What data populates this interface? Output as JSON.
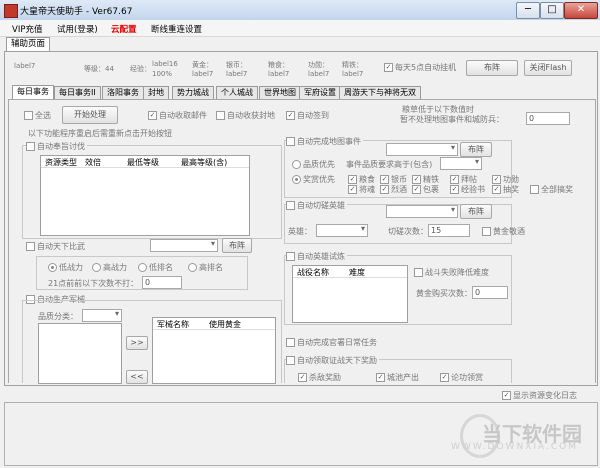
{
  "window": {
    "title": "大皇帝天使助手 - Ver67.67",
    "min": "─",
    "max": "□",
    "close": "✕"
  },
  "menu": {
    "items": [
      "VIP充值",
      "试用(登录)",
      "云配置",
      "断线重连设置"
    ],
    "accent": "#e00000"
  },
  "main_tab": "辅助页面",
  "stats": {
    "label17_a": "label7",
    "level_label": "等级：44",
    "exp_label": "经验：",
    "exp_value": "label16",
    "exp_pct": "100%",
    "gold_label": "黄金：",
    "gold_value": "label7",
    "silver_label": "银币：",
    "silver_value": "label7",
    "food_label": "粮食：",
    "food_value": "label7",
    "merit_label": "功勋：",
    "merit_value": "label7",
    "iron_label": "精铁：",
    "iron_value": "label7",
    "auto_hang": "每天5点自动挂机",
    "layout_btn": "布阵",
    "flash_btn": "关闭Flash"
  },
  "tabs": [
    "每日事务",
    "每日事务II",
    "洛阳事务",
    "封地",
    "势力城战",
    "个人城战",
    "世界地图",
    "军府设置",
    "周游天下与神将无双"
  ],
  "left": {
    "select_all": "全选",
    "start_btn": "开始处理",
    "auto_mail": "自动收取邮件",
    "auto_fief": "自动收获封地",
    "auto_sign": "自动签到",
    "note": "以下功能程序重启后需重新点击开始按钮",
    "rep_title": "自动奉旨讨伐",
    "rep_headers": [
      "资源类型",
      "效倍",
      "最低等级",
      "最高等级(含)"
    ],
    "rank_title": "自动天下比武",
    "rank_btn": "布阵",
    "rank_opts": [
      "低战力",
      "高战力",
      "低排名",
      "高排名"
    ],
    "rank_note": "21点前前以下次数不打：",
    "rank_value": "0",
    "army_title": "自动生产军械",
    "quality_label": "品质分类：",
    "arrow_right": ">>",
    "arrow_left": "<<",
    "army_headers": [
      "军械名称",
      "使用黄金"
    ]
  },
  "right": {
    "food_note1": "粮草低于以下数值时",
    "food_note2": "暂不处理地图事件和城防兵：",
    "food_value": "0",
    "map_title": "自动完成地图事件",
    "map_btn": "布阵",
    "quality_first": "品质优先",
    "event_quality": "事件品质要求高于(包含)",
    "reward_first": "奖赏优先",
    "rewards": [
      "粮食",
      "银币",
      "精铁",
      "拜帖",
      "功勋",
      "将魂",
      "烈酒",
      "包裹",
      "经验书",
      "抽奖",
      "全部搞奖"
    ],
    "cut_title": "自动切磋英雄",
    "cut_btn": "布阵",
    "hero_label": "英雄：",
    "cut_count_label": "切磋次数：",
    "cut_count": "15",
    "gold_wine": "黄金敬酒",
    "trial_title": "自动英雄试炼",
    "trial_headers": [
      "战役名称",
      "难度"
    ],
    "fail_lower": "战斗失败降低难度",
    "buy_label": "黄金购买次数：",
    "buy_value": "0",
    "official_task": "自动完成官署日常任务",
    "campaign_title": "自动领取证战天下奖励",
    "campaign_items": [
      "杀敌奖励",
      "城池产出",
      "论功领赏"
    ]
  },
  "footer": {
    "show_log": "显示资源变化日志"
  },
  "watermark": {
    "brand": "当下软件园",
    "url": "WWW.DOWNXIA.COM"
  }
}
